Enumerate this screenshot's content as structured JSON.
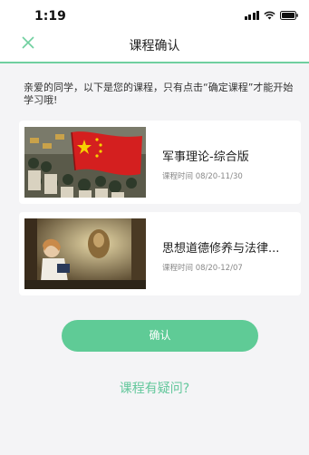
{
  "status": {
    "time": "1:19"
  },
  "nav": {
    "title": "课程确认"
  },
  "notice": "亲爱的同学，以下是您的课程，只有点击“确定课程”才能开始学习哦!",
  "courses": [
    {
      "title": "军事理论-综合版",
      "time": "课程时间 08/20-11/30"
    },
    {
      "title": "思想道德修养与法律...",
      "time": "课程时间 08/20-12/07"
    }
  ],
  "actions": {
    "confirm_label": "确认",
    "question_label": "课程有疑问?"
  },
  "colors": {
    "accent": "#5fcb96",
    "link": "#62c79b",
    "background": "#f4f4f6"
  }
}
